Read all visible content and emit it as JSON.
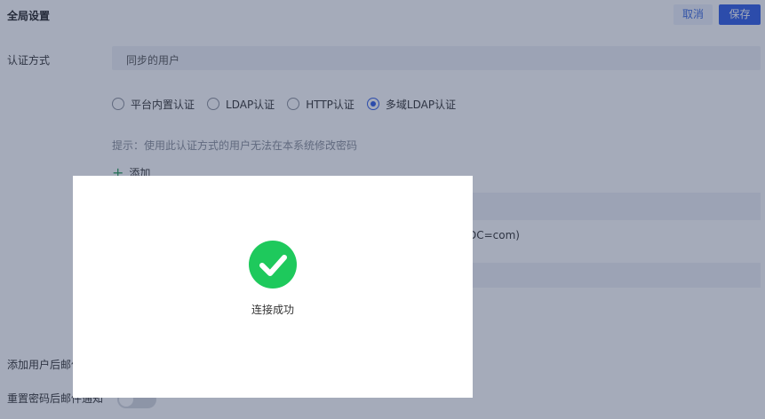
{
  "header": {
    "title": "全局设置",
    "cancel_label": "取消",
    "save_label": "保存"
  },
  "auth": {
    "label": "认证方式",
    "sync_title": "同步的用户",
    "options": [
      {
        "label": "平台内置认证",
        "selected": false
      },
      {
        "label": "LDAP认证",
        "selected": false
      },
      {
        "label": "HTTP认证",
        "selected": false
      },
      {
        "label": "多域LDAP认证",
        "selected": true
      }
    ],
    "hint": "提示：使用此认证方式的用户无法在本系统修改密码",
    "add_label": "添加",
    "table_cell_partial": "DC=com)"
  },
  "notifications": {
    "add_user_label": "添加用户后邮件通知",
    "reset_password_label": "重置密码后邮件通知"
  },
  "modal": {
    "icon": "check-circle-icon",
    "message": "连接成功"
  },
  "colors": {
    "primary": "#2f5ce6",
    "success": "#1ec95c",
    "overlay": "rgba(40,55,90,0.42)"
  }
}
